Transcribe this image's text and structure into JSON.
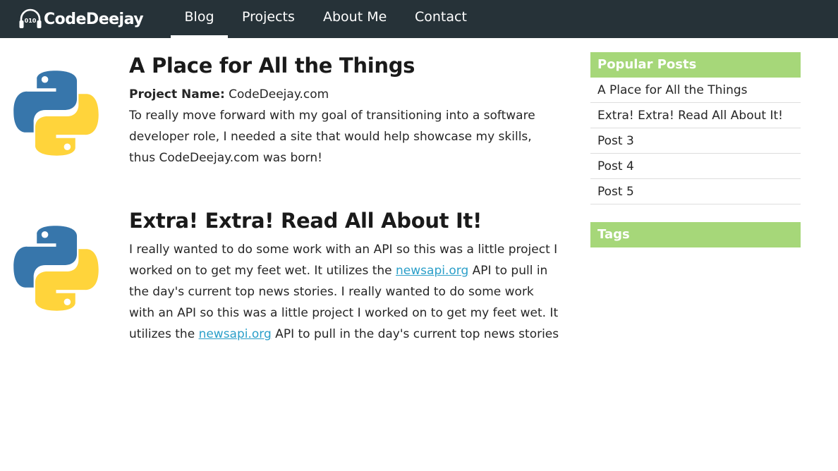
{
  "nav": {
    "logo_text": "CodeDeejay",
    "logo_badge": "010",
    "links": [
      "Blog",
      "Projects",
      "About Me",
      "Contact"
    ],
    "active": "Blog"
  },
  "posts": [
    {
      "title": "A Place for All the Things",
      "icon": "python-logo-icon",
      "project_label": "Project Name:",
      "project_value": "CodeDeejay.com",
      "body": "To really move forward with my goal of transitioning into a software developer role, I needed a site that would help showcase my skills, thus CodeDeejay.com was born!"
    },
    {
      "title": "Extra! Extra! Read All About It!",
      "icon": "python-logo-icon",
      "body_1": "I really wanted to do some work with an API so this was a little project I worked on to get my feet wet. It utilizes the ",
      "link_1": "newsapi.org",
      "body_2": " API to pull in the day's current top news stories. I really wanted to do some work with an API so this was a little project I worked on to get my feet wet. It utilizes the ",
      "link_2": "newsapi.org",
      "body_3": " API to pull in the day's current top news stories"
    }
  ],
  "sidebar": {
    "popular_title": "Popular Posts",
    "popular_items": [
      "A Place for All the Things",
      "Extra! Extra! Read All About It!",
      "Post 3",
      "Post 4",
      "Post 5"
    ],
    "tags_title": "Tags"
  },
  "colors": {
    "navbar": "#263238",
    "sidebar_accent": "#a6d779",
    "link": "#2b9fc9",
    "python_blue": "#3776ab",
    "python_yellow": "#ffd43b"
  }
}
